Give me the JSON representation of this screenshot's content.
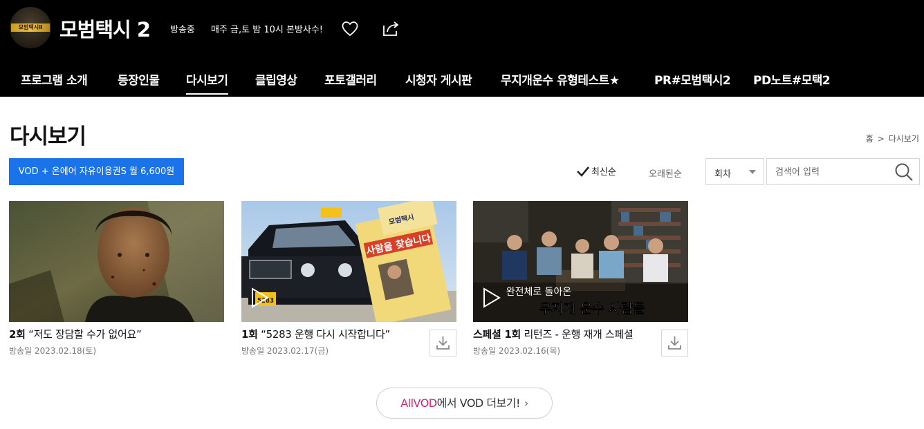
{
  "header": {
    "logo_text": "모범택시Ⅱ",
    "show_title": "모범택시 2",
    "status": "방송중",
    "schedule": "매주 금,토 밤 10시 본방사수!"
  },
  "nav": {
    "items": [
      {
        "label": "프로그램 소개",
        "active": false
      },
      {
        "label": "등장인물",
        "active": false
      },
      {
        "label": "다시보기",
        "active": true
      },
      {
        "label": "클립영상",
        "active": false
      },
      {
        "label": "포토갤러리",
        "active": false
      },
      {
        "label": "시청자 게시판",
        "active": false
      },
      {
        "label": "무지개운수 유형테스트★",
        "active": false
      },
      {
        "label": "PR#모범택시2",
        "active": false
      },
      {
        "label": "PD노트#모택2",
        "active": false
      }
    ]
  },
  "page": {
    "title": "다시보기",
    "breadcrumb": [
      "홈",
      ">",
      "다시보기"
    ]
  },
  "toolbar": {
    "promo_label": "VOD + 온에어 자유이용권S 월 6,600원",
    "sort_latest": "최신순",
    "sort_oldest": "오래된순",
    "select_value": "회차",
    "search_placeholder": "검색어 입력"
  },
  "episodes": [
    {
      "ep": "2회",
      "title": "“저도 장담할 수가 없어요”",
      "date": "방송일 2023.02.18(토)"
    },
    {
      "ep": "1회",
      "title": "“5283 운행 다시 시작합니다”",
      "date": "방송일 2023.02.17(금)"
    },
    {
      "ep": "스페셜 1회",
      "title": "리턴즈 - 운행 재개 스페셜",
      "date": "방송일 2023.02.16(목)"
    }
  ],
  "thumb_text": {
    "plate": "5283",
    "poster_title": "사람을 찾습니다",
    "poster_top": "모범택시",
    "special_line1": "완전체로 돌아온",
    "special_line2": "무지개 운수 사람들"
  },
  "more": {
    "brand": "AllVOD",
    "rest": "에서 VOD 더보기!",
    "chevron": "›"
  },
  "colors": {
    "header_bg": "#000000",
    "promo_bg": "#1a73e8",
    "brand_pink": "#d6246e"
  },
  "icons": [
    "heart-icon",
    "share-icon",
    "check-icon",
    "chevron-down-icon",
    "search-icon",
    "download-icon",
    "play-icon",
    "chevron-right-icon"
  ]
}
